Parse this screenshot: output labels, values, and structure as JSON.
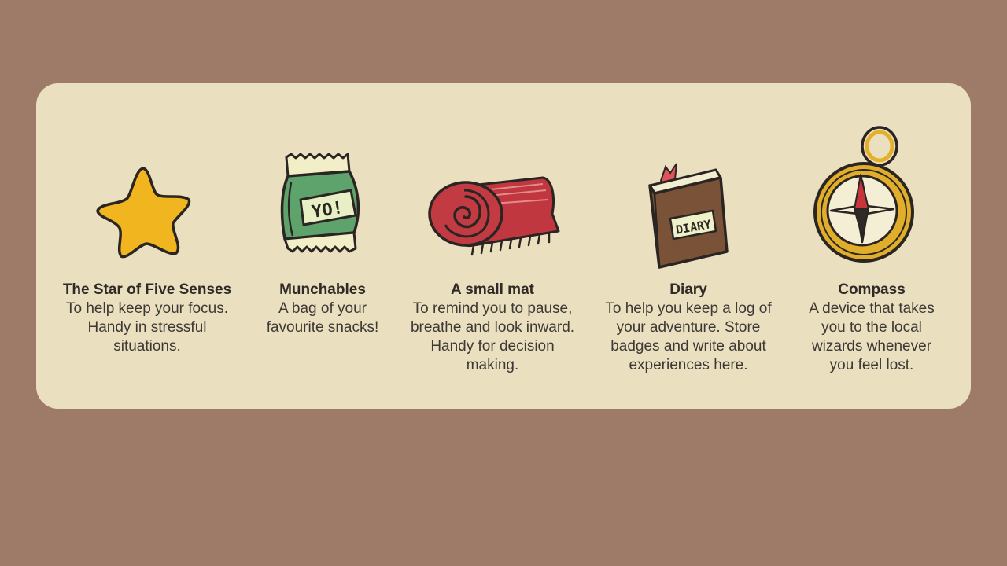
{
  "background_color": "#9e7b69",
  "card_color": "#eae0c0",
  "items": [
    {
      "icon": "star-icon",
      "title": "The Star of Five Senses",
      "description": "To help keep your focus. Handy in stressful situations."
    },
    {
      "icon": "snack-bag-icon",
      "title": "Munchables",
      "description": "A bag of your favourite snacks!",
      "bag_label": "YO!"
    },
    {
      "icon": "rolled-mat-icon",
      "title": "A small mat",
      "description": "To remind you to pause, breathe and look inward. Handy for decision making."
    },
    {
      "icon": "diary-book-icon",
      "title": "Diary",
      "description": "To help you keep a log of your adventure. Store badges and write about experiences here.",
      "book_label": "DIARY"
    },
    {
      "icon": "compass-icon",
      "title": "Compass",
      "description": "A device that takes you to the local wizards whenever you feel lost."
    }
  ]
}
